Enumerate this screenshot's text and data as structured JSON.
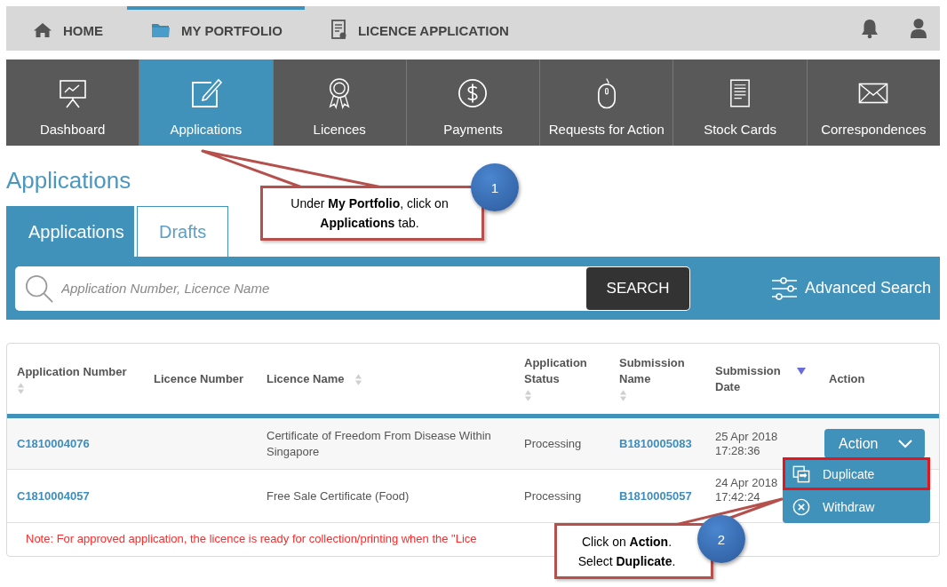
{
  "top_nav": {
    "items": [
      {
        "label": "HOME",
        "selected": false
      },
      {
        "label": "MY PORTFOLIO",
        "selected": true
      },
      {
        "label": "LICENCE APPLICATION",
        "selected": false
      }
    ]
  },
  "module_tabs": [
    {
      "label": "Dashboard",
      "selected": false
    },
    {
      "label": "Applications",
      "selected": true
    },
    {
      "label": "Licences",
      "selected": false
    },
    {
      "label": "Payments",
      "selected": false
    },
    {
      "label": "Requests for Action",
      "selected": false
    },
    {
      "label": "Stock Cards",
      "selected": false
    },
    {
      "label": "Correspondences",
      "selected": false
    }
  ],
  "page_title": "Applications",
  "sub_tabs": [
    {
      "label": "Applications",
      "selected": true
    },
    {
      "label": "Drafts",
      "selected": false
    }
  ],
  "search": {
    "placeholder": "Application Number, Licence Name",
    "button": "SEARCH",
    "advanced_search": "Advanced Search"
  },
  "table": {
    "columns": [
      {
        "label": "Application Number",
        "sortable": true,
        "sorted_descending": false
      },
      {
        "label": "Licence Number",
        "sortable": false,
        "sorted_descending": false
      },
      {
        "label": "Licence Name",
        "sortable": true,
        "sorted_descending": false
      },
      {
        "label": "Application Status",
        "sortable": true,
        "sorted_descending": false
      },
      {
        "label": "Submission Name",
        "sortable": true,
        "sorted_descending": false
      },
      {
        "label": "Submission Date",
        "sortable": true,
        "sorted_descending": true
      },
      {
        "label": "Action",
        "sortable": false,
        "sorted_descending": false
      }
    ],
    "rows": [
      {
        "application_number": "C1810004076",
        "licence_name": "Certificate of Freedom From Disease Within Singapore",
        "application_status": "Processing",
        "submission_name": "B1810005083",
        "submission_date": "25 Apr 2018 17:28:36",
        "selected": true,
        "action": "Action"
      },
      {
        "application_number": "C1810004057",
        "licence_name": "Free Sale Certificate (Food)",
        "application_status": "Processing",
        "submission_name": "B1810005057",
        "submission_date": "24 Apr 2018 17:42:24",
        "selected": false
      }
    ],
    "note": "Note: For approved application, the licence is ready for collection/printing when the \"Lice"
  },
  "action_menu": {
    "items": [
      {
        "label": "Duplicate",
        "kind": "duplicate",
        "highlighted": true
      },
      {
        "label": "Withdraw",
        "kind": "withdraw",
        "highlighted": false
      }
    ]
  },
  "callouts": [
    {
      "number": "1",
      "text": "Under **My Portfolio**, click on **Applications** tab."
    },
    {
      "number": "2",
      "text": "Click on **Action**. Select **Duplicate**."
    }
  ]
}
